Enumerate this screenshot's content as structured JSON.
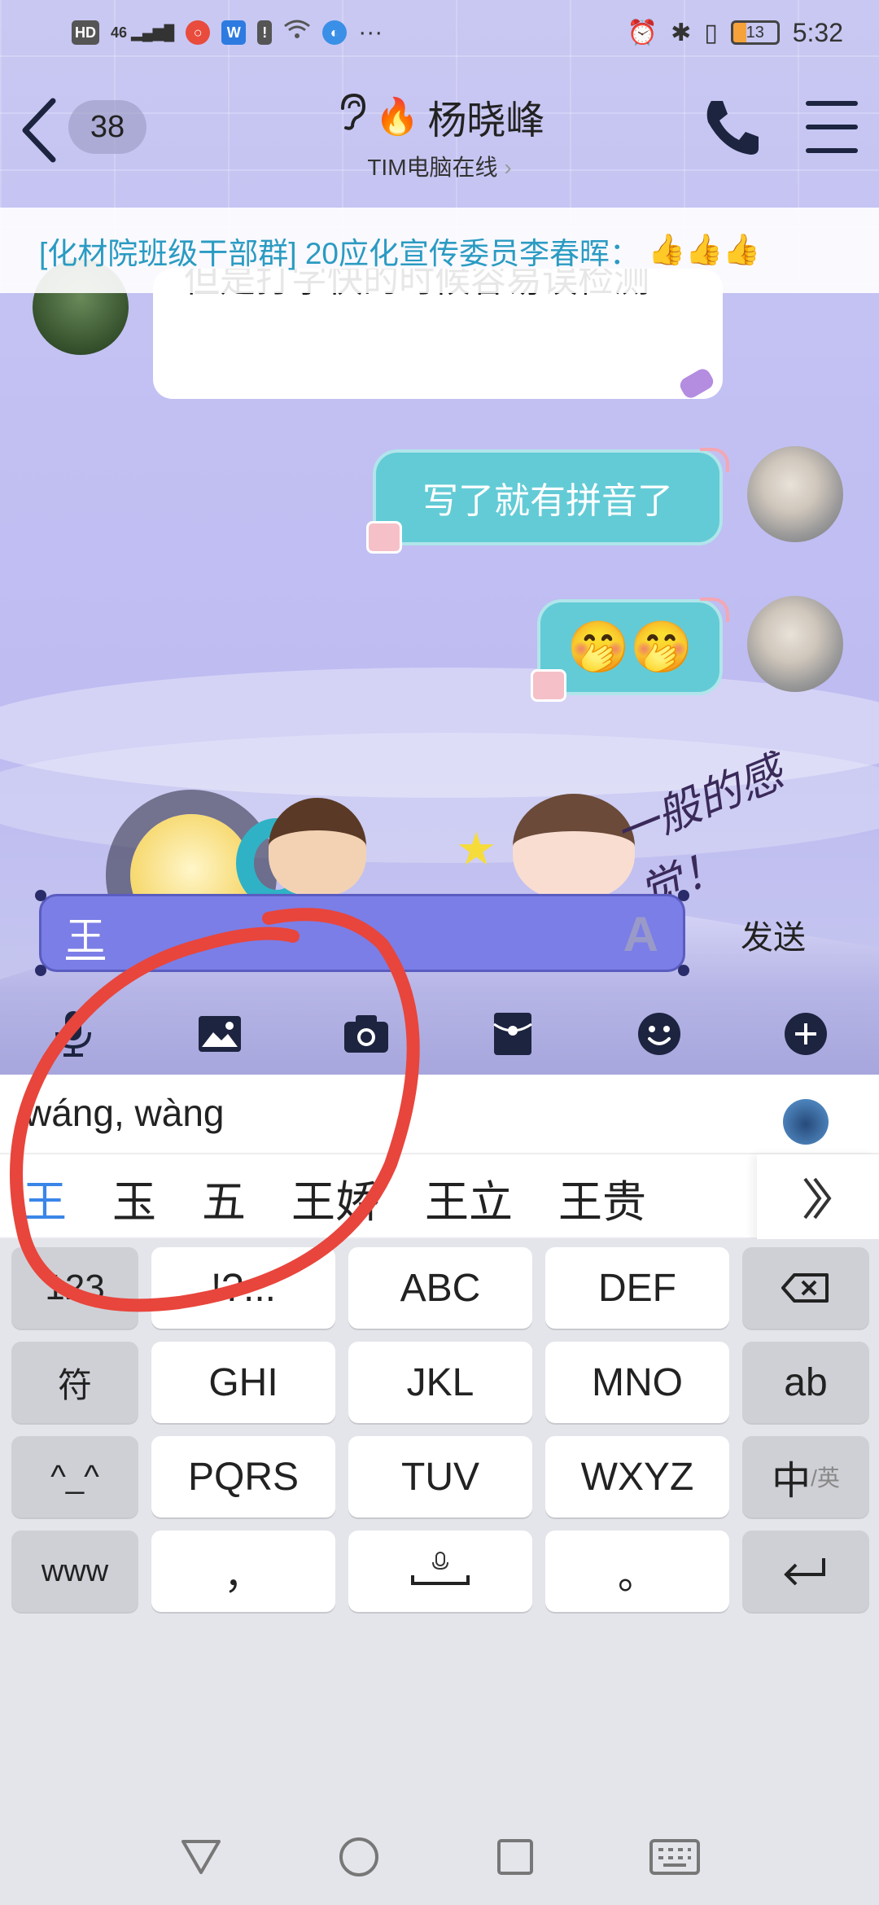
{
  "status_bar": {
    "left_icons": [
      "hd-icon",
      "4g-signal-icon",
      "search-app-icon",
      "wps-app-icon",
      "warning-icon",
      "wifi-icon",
      "browser-app-icon",
      "more-dots-icon"
    ],
    "hd_label": "HD",
    "network_label": "46",
    "dots": "···",
    "battery": "13",
    "time": "5:32"
  },
  "header": {
    "unread_count": "38",
    "name": "杨晓峰",
    "subtitle": "TIM电脑在线",
    "subtitle_chevron": "›"
  },
  "notice": {
    "text": "[化材院班级干部群] 20应化宣传委员李春晖：",
    "emoji": "👍👍👍"
  },
  "messages": [
    {
      "side": "left",
      "text": "但是打字快的时候容易误检测"
    },
    {
      "side": "right",
      "text": "写了就有拼音了"
    },
    {
      "side": "right",
      "text": "🤭🤭"
    }
  ],
  "sticker_caption": "一般的感觉！",
  "input": {
    "value": "王",
    "font_icon": "A",
    "send_label": "发送"
  },
  "toolbar": {
    "items": [
      "voice-icon",
      "image-icon",
      "camera-icon",
      "red-packet-icon",
      "emoji-icon",
      "plus-icon"
    ]
  },
  "ime": {
    "pinyin": "wáng, wàng",
    "candidates": [
      "王",
      "玉",
      "五",
      "王娇",
      "王立",
      "王贵"
    ],
    "more": "》"
  },
  "keyboard": {
    "rows": [
      [
        "123",
        "!?...",
        "ABC",
        "DEF",
        "⌫"
      ],
      [
        "符",
        "GHI",
        "JKL",
        "MNO",
        "ab"
      ],
      [
        "^_^",
        "PQRS",
        "TUV",
        "WXYZ",
        "中"
      ],
      [
        "www",
        "，",
        "␣",
        "。",
        "↵"
      ]
    ],
    "switch_sub": "/英"
  },
  "colors": {
    "accent_teal": "#63cbd6",
    "notice_text": "#2a9bc2",
    "input_fill": "#7b7ee6",
    "annotation_red": "#e8453c",
    "candidate_active": "#3a86e8"
  }
}
